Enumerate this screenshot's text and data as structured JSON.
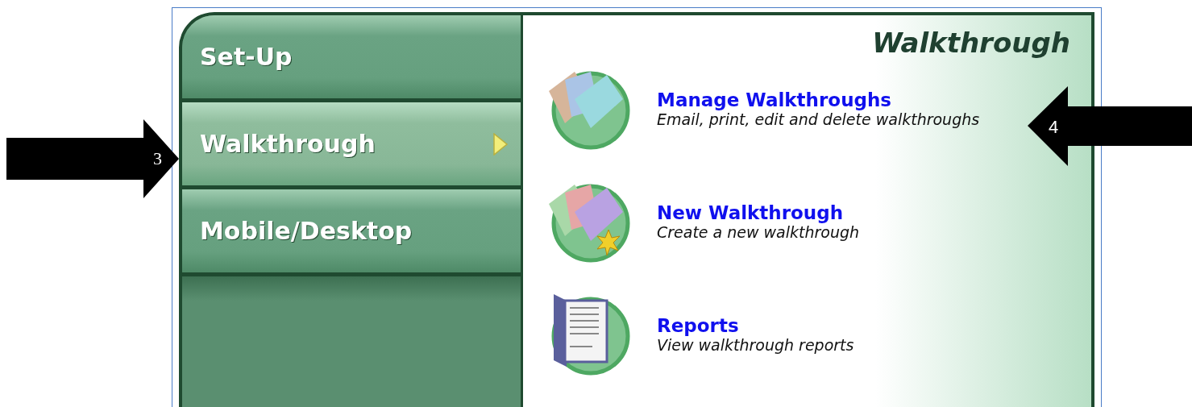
{
  "sidebar": {
    "items": [
      {
        "label": "Set-Up",
        "selected": false
      },
      {
        "label": "Walkthrough",
        "selected": true
      },
      {
        "label": "Mobile/Desktop",
        "selected": false
      }
    ]
  },
  "content": {
    "title": "Walkthrough",
    "items": [
      {
        "kind": "manage",
        "title": "Manage Walkthroughs",
        "description": "Email, print, edit and delete walkthroughs"
      },
      {
        "kind": "new",
        "title": "New Walkthrough",
        "description": "Create a new walkthrough"
      },
      {
        "kind": "reports",
        "title": "Reports",
        "description": "View walkthrough reports"
      }
    ]
  },
  "callouts": [
    {
      "kind": "right",
      "label": "3"
    },
    {
      "kind": "left",
      "label": "4"
    }
  ]
}
